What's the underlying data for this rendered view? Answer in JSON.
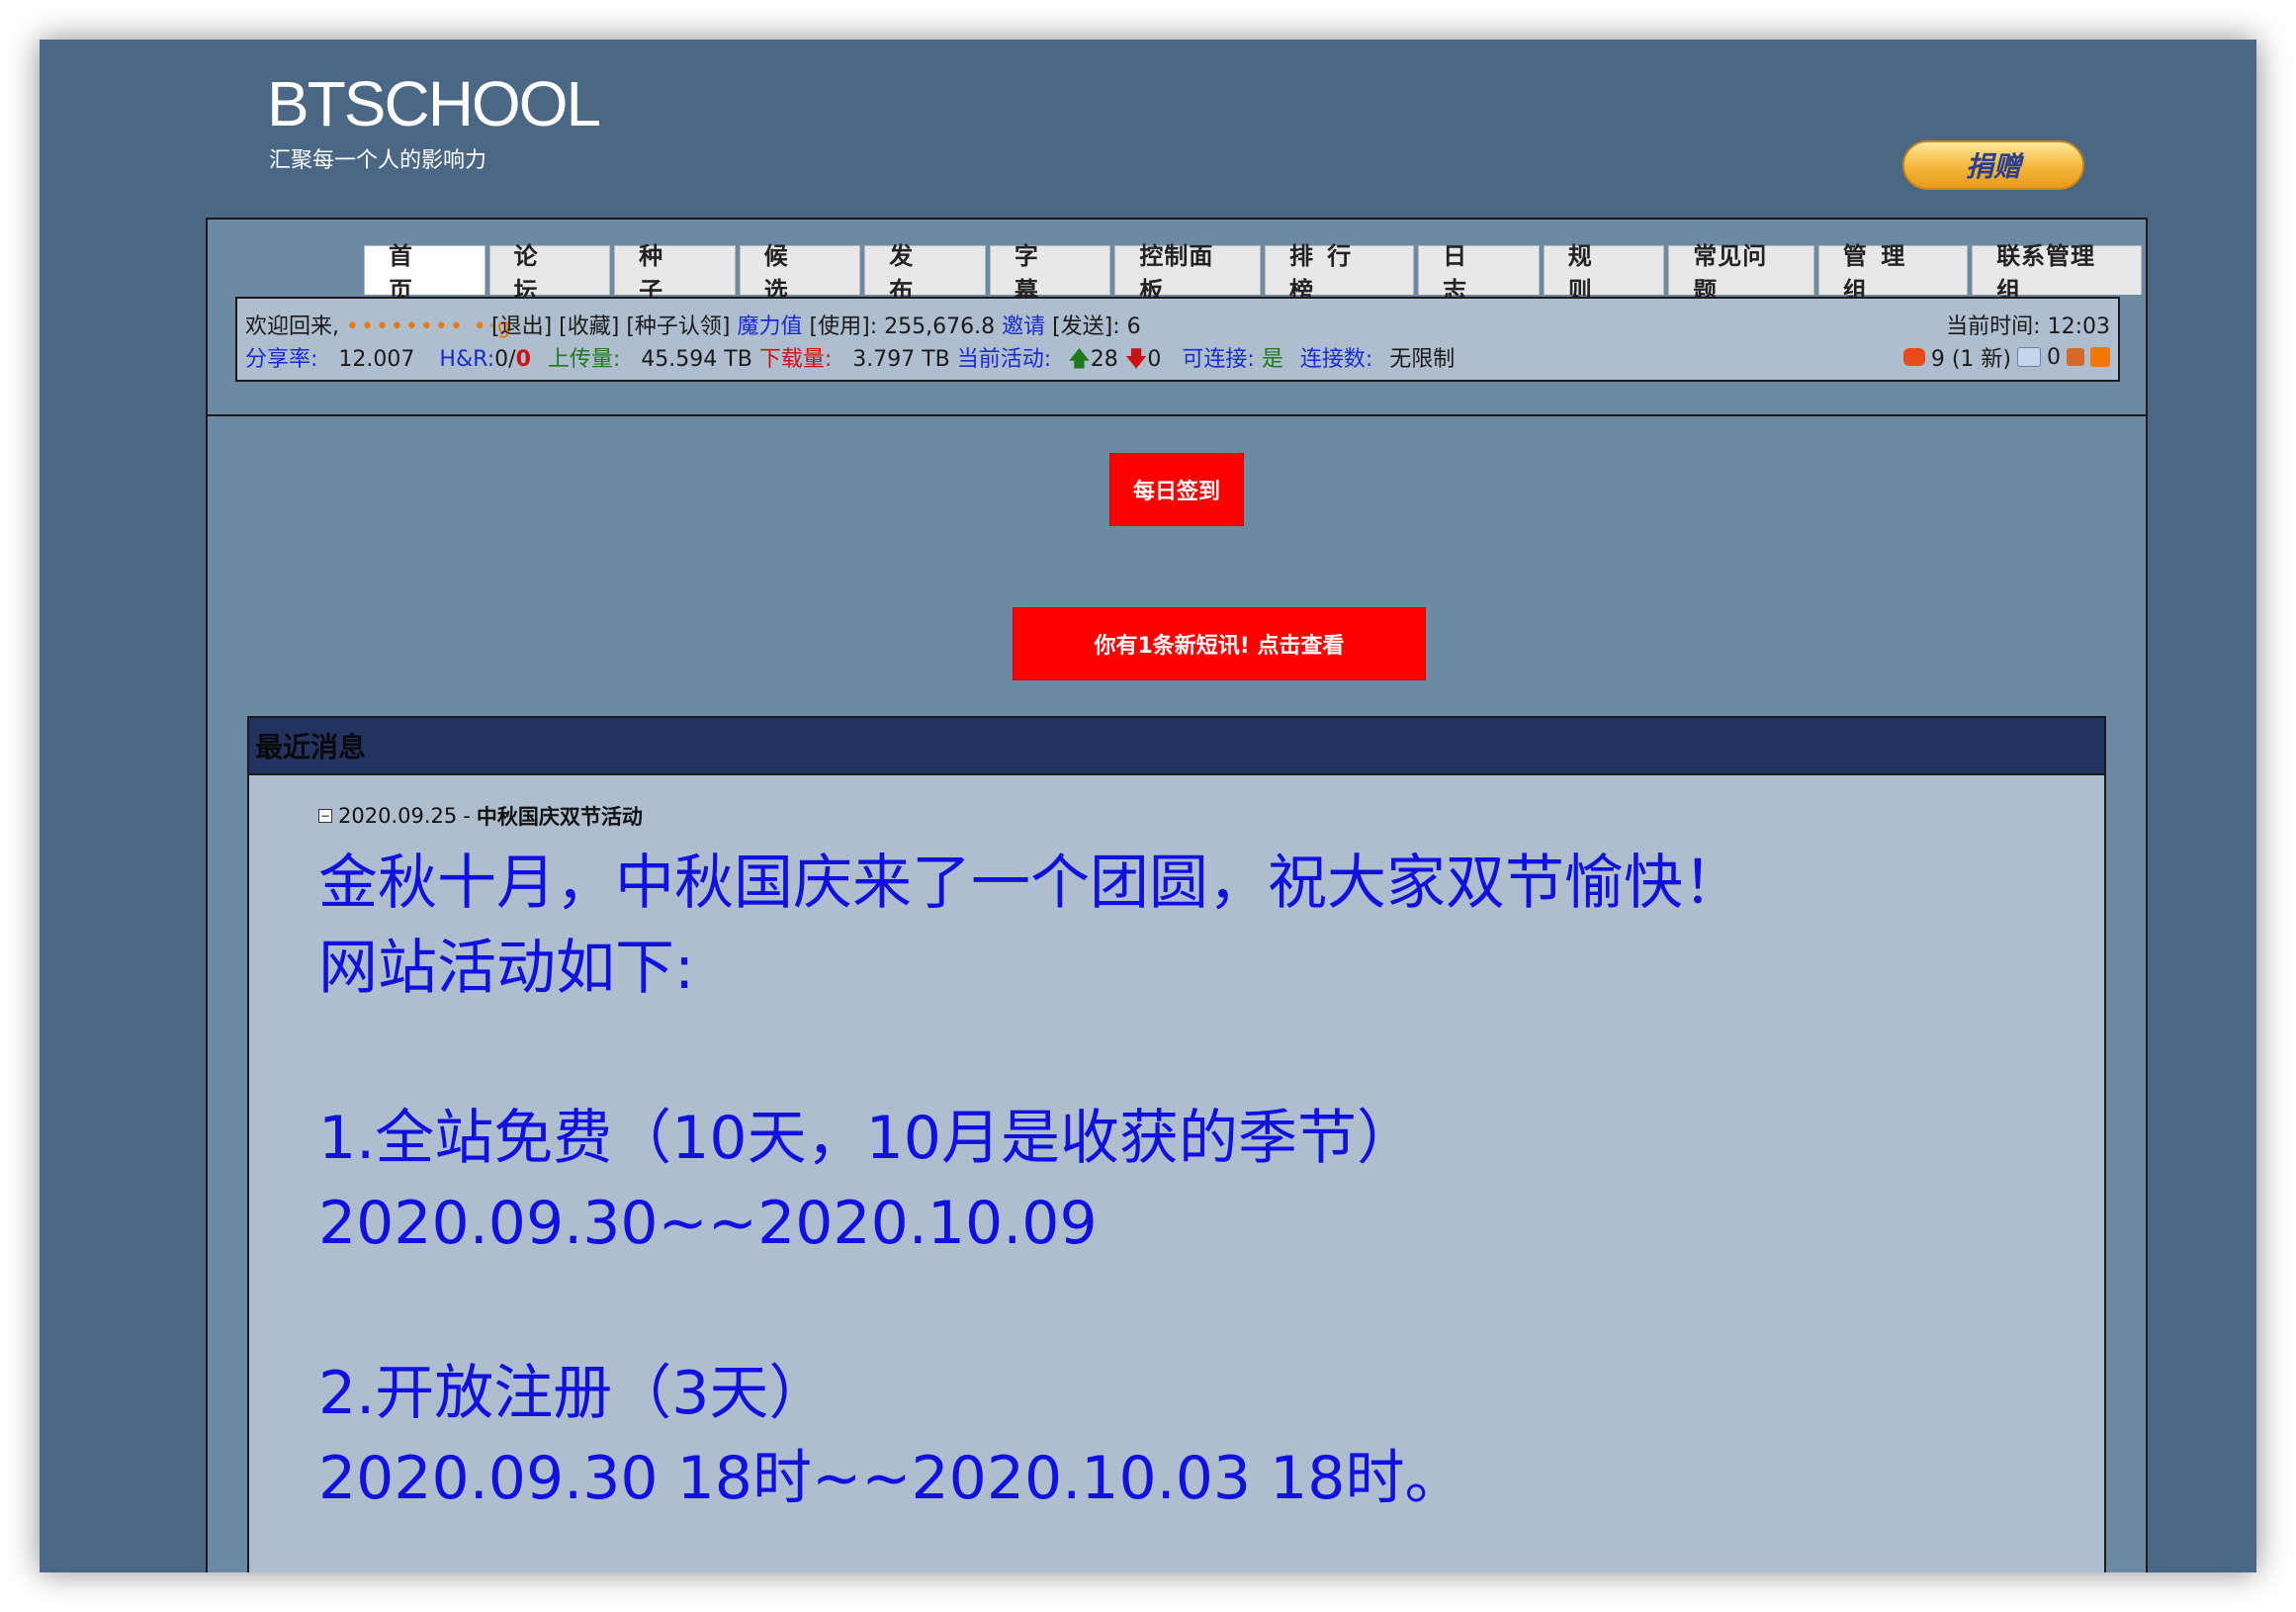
{
  "site": {
    "logo": "BTSCHOOL",
    "slogan": "汇聚每一个人的影响力",
    "donate_label": "捐赠"
  },
  "nav": [
    "首 页",
    "论 坛",
    "种 子",
    "候 选",
    "发 布",
    "字 幕",
    "控制面板",
    "排 行 榜",
    "日 志",
    "规 则",
    "常见问题",
    "管 理 组",
    "联系管理组"
  ],
  "user_bar": {
    "welcome": "欢迎回来,",
    "username": "•••••••• •·g",
    "logout": "[退出]",
    "favorites": "[收藏]",
    "claim": "[种子认领]",
    "bonus_label": "魔力值",
    "bonus_value": "[使用]: 255,676.8",
    "invite_label": "邀请",
    "invite_value": "[发送]: 6",
    "ratio_label": "分享率:",
    "ratio_value": "12.007",
    "hr_label": "H&R:",
    "hr_value_a": "0/",
    "hr_value_b": "0",
    "upload_label": "上传量:",
    "upload_value": "45.594 TB",
    "download_label": "下载量:",
    "download_value": "3.797 TB",
    "active_label": "当前活动:",
    "active_seed": "28",
    "active_leech": "0",
    "connectable_label": "可连接:",
    "connectable_value": "是",
    "connections_label": "连接数:",
    "connections_value": "无限制",
    "time_label": "当前时间:",
    "time_value": "12:03",
    "messages": "9 (1 新)",
    "friends_count": "0"
  },
  "buttons": {
    "checkin": "每日签到",
    "new_message": "你有1条新短讯! 点击查看"
  },
  "news": {
    "header": "最近消息",
    "date": "2020.09.25",
    "separator": "-",
    "title": "中秋国庆双节活动",
    "lines": [
      "金秋十月，中秋国庆来了一个团圆，祝大家双节愉快！",
      "网站活动如下:",
      "",
      "1.全站免费（10天，10月是收获的季节）",
      "2020.09.30~~2020.10.09",
      "",
      "2.开放注册（3天）",
      "2020.09.30 18时~~2020.10.03  18时。"
    ]
  },
  "colors": {
    "background": "#4a6886",
    "panel": "#aebecf",
    "news_header": "#223361",
    "link_blue": "#1a2ccf",
    "alert_red": "#ff0000",
    "news_text": "#1010e0"
  }
}
